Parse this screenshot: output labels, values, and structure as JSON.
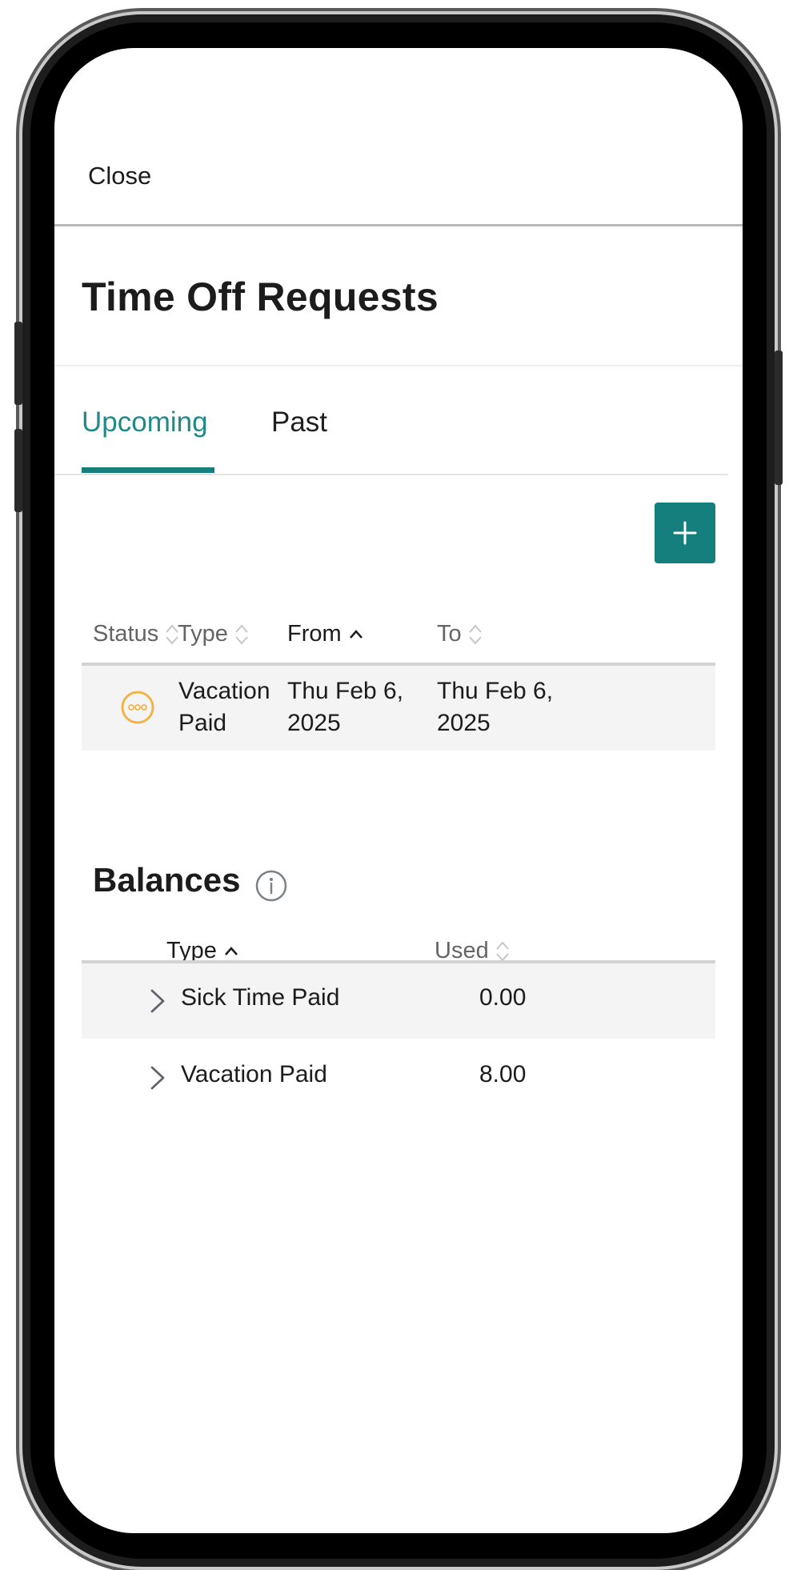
{
  "header": {
    "close_label": "Close"
  },
  "page": {
    "title": "Time Off Requests"
  },
  "tabs": [
    {
      "label": "Upcoming",
      "active": true
    },
    {
      "label": "Past",
      "active": false
    }
  ],
  "requests": {
    "columns": {
      "status": "Status",
      "type": "Type",
      "from": "From",
      "to": "To"
    },
    "rows": [
      {
        "status_icon": "pending-icon",
        "type_line1": "Vacation",
        "type_line2": "Paid",
        "from_line1": "Thu Feb 6,",
        "from_line2": "2025",
        "to_line1": "Thu Feb 6,",
        "to_line2": "2025"
      }
    ]
  },
  "balances": {
    "title": "Balances",
    "columns": {
      "type": "Type",
      "used": "Used"
    },
    "rows": [
      {
        "type": "Sick Time Paid",
        "used": "0.00"
      },
      {
        "type": "Vacation Paid",
        "used": "8.00"
      }
    ]
  },
  "colors": {
    "accent": "#147f7c",
    "pending": "#f0b44a",
    "text": "#1c1c1c",
    "muted": "#646464"
  }
}
